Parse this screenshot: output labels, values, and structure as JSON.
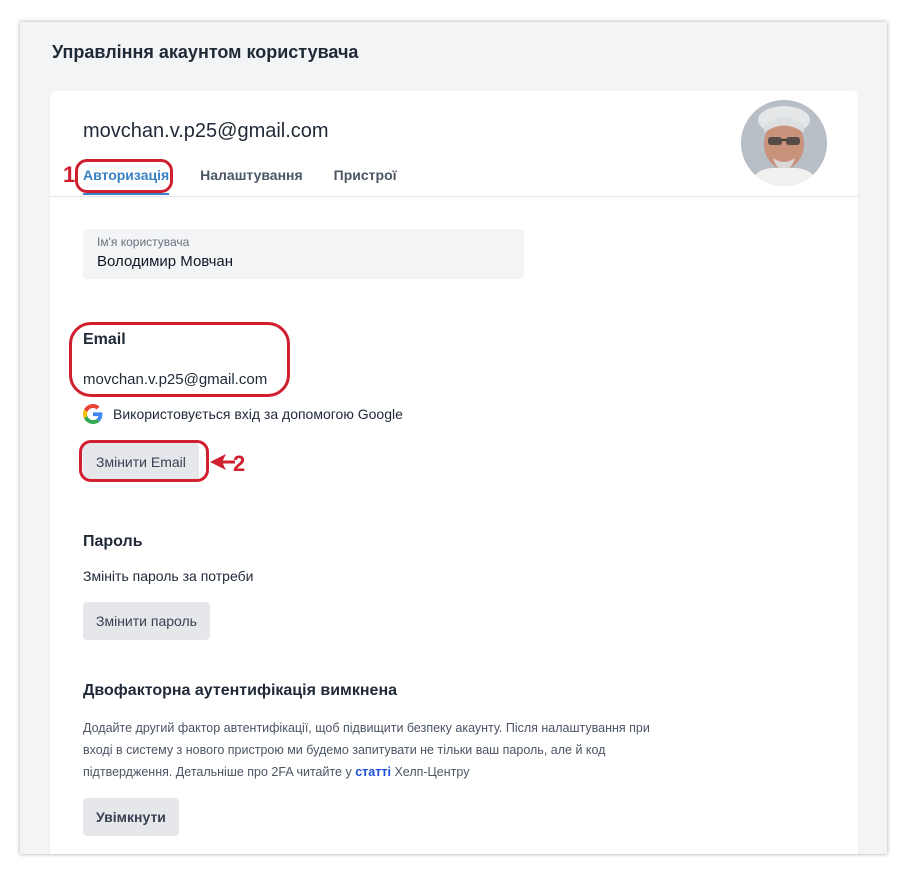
{
  "page_title": "Управління акаунтом користувача",
  "account": {
    "email": "movchan.v.p25@gmail.com",
    "avatar_icon": "user-photo"
  },
  "tabs": [
    {
      "label": "Авторизація",
      "active": true
    },
    {
      "label": "Налаштування",
      "active": false
    },
    {
      "label": "Пристрої",
      "active": false
    }
  ],
  "username": {
    "label": "Ім'я користувача",
    "value": "Володимир Мовчан"
  },
  "email_section": {
    "title": "Email",
    "value": "movchan.v.p25@gmail.com",
    "google_note": "Використовується вхід за допомогою Google",
    "google_icon": "google-g-icon",
    "button_label": "Змінити Email"
  },
  "password_section": {
    "title": "Пароль",
    "note": "Змініть пароль за потреби",
    "button_label": "Змінити пароль"
  },
  "twofa_section": {
    "title": "Двофакторна аутентифікація вимкнена",
    "desc_before_link": "Додайте другий фактор автентифікації, щоб підвищити безпеку акаунту. Після налаштування при вході в систему з нового пристрою ми будемо запитувати не тільки ваш пароль, але й код підтвердження. Детальніше про 2FA читайте у",
    "link_text": "статті",
    "desc_after_link": "Хелп-Центру",
    "button_label": "Увімкнути"
  },
  "annotations": {
    "marker_1": "1",
    "marker_2": "2",
    "color": "#d01f2f"
  },
  "colors": {
    "accent": "#3b82c4",
    "link": "#1d4ed8",
    "background": "#f3f4f6"
  }
}
